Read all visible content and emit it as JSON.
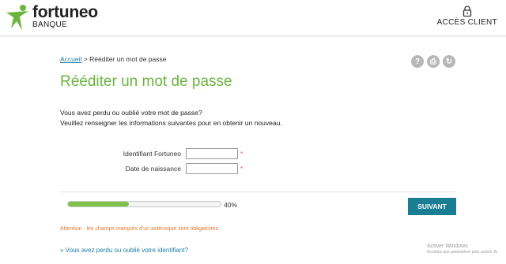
{
  "header": {
    "brand": "fortuneo",
    "brand_sub": "BANQUE",
    "client_access": "ACCÈS CLIENT",
    "logo_color": "#6cb33f"
  },
  "breadcrumb": {
    "home": "Accueil",
    "separator": ">",
    "current": "Rééditer un mot de passe"
  },
  "tools": [
    {
      "icon": "help-icon",
      "glyph": "?"
    },
    {
      "icon": "print-icon",
      "glyph": "⎙"
    },
    {
      "icon": "refresh-icon",
      "glyph": "↻"
    }
  ],
  "page": {
    "title": "Rééditer un mot de passe",
    "intro_line1": "Vous avez perdu ou oublié votre mot de passe?",
    "intro_line2": "Veuillez renseigner les informations suivantes pour en obtenir un nouveau."
  },
  "form": {
    "identifier_label": "Identifiant Fortuneo",
    "identifier_value": "",
    "birthdate_label": "Date de naissance",
    "birthdate_value": "",
    "required_mark": "*"
  },
  "progress": {
    "value": 0.4,
    "label": "40%"
  },
  "next_button": "SUIVANT",
  "warning": "Attention : les champs marqués d'un astérisque sont obligatoires.",
  "forgot_identifier": "» Vous avez perdu ou oublié votre identifiant?",
  "watermark": {
    "line1": "Activer Windows",
    "line2": "Accédez aux paramètres pour activer W"
  },
  "colors": {
    "accent_green": "#6cb33f",
    "button_teal": "#1a7e92",
    "link_blue": "#1d7fa3",
    "warning_orange": "#e07a2e"
  }
}
